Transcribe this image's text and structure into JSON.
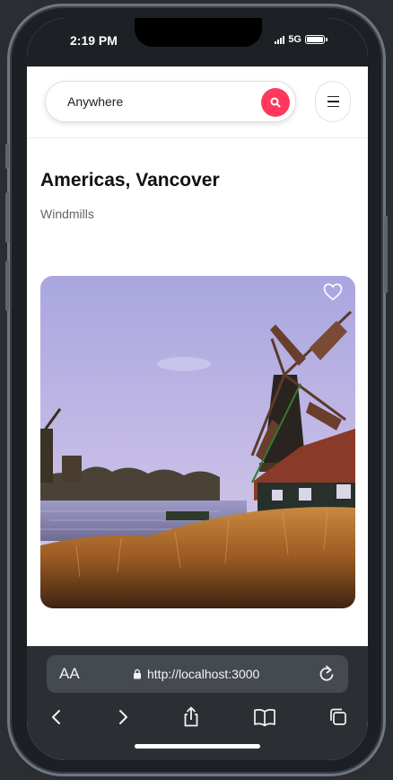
{
  "status_bar": {
    "time": "2:19 PM",
    "network": "5G",
    "icons": [
      "signal-icon",
      "battery-icon"
    ]
  },
  "header": {
    "search_label": "Anywhere",
    "search_icon": "search-icon",
    "menu_icon": "hamburger-menu-icon",
    "accent_color": "#ff385c"
  },
  "listing": {
    "title": "Americas, Vancover",
    "subtitle": "Windmills",
    "image": "windmills-photo",
    "favorite_icon": "heart-icon"
  },
  "browser": {
    "text_size_label": "AA",
    "url": "http://localhost:3000",
    "icons": [
      "lock-icon",
      "reload-icon",
      "back-icon",
      "forward-icon",
      "share-icon",
      "bookmarks-icon",
      "tabs-icon"
    ]
  }
}
